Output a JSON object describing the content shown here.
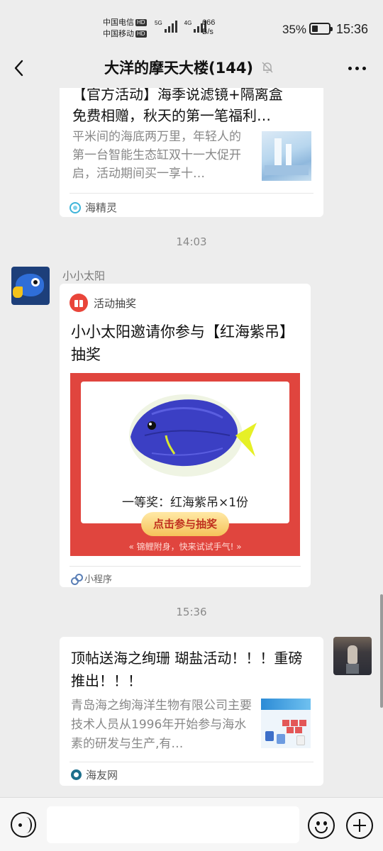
{
  "status_bar": {
    "carrier1": "中国电信",
    "carrier2": "中国移动",
    "hd": "HD",
    "net1": "5G",
    "net2": "4G",
    "speed_value": "666",
    "speed_unit": "B/s",
    "battery_percent": "35%",
    "battery_level": 0.35,
    "time": "15:36"
  },
  "header": {
    "title": "大洋的摩天大楼(144)",
    "icons": {
      "back": "chevron-left-icon",
      "mute": "bell-off-icon",
      "more": "more-horizontal-icon"
    }
  },
  "messages": {
    "article1": {
      "title_line1": "【官方活动】海季说滤镜+隔离盒",
      "title_line2": "免费相赠，秋天的第一笔福利…",
      "desc": "平米间的海底两万里，年轻人的第一台智能生态缸双十一大促开启，活动期间买一享十…",
      "source": "海精灵"
    },
    "time1": "14:03",
    "lottery": {
      "sender": "小小太阳",
      "tag": "活动抽奖",
      "title": "小小太阳邀请你参与【红海紫吊】抽奖",
      "prize": "一等奖：红海紫吊×1份",
      "button": "点击参与抽奖",
      "slogan": "«   锦鲤附身，快来试试手气!   »",
      "source": "小程序"
    },
    "time2": "15:36",
    "article2": {
      "title": "顶帖送海之绚珊 瑚盐活动！！！重磅推出！！！",
      "desc": "青岛海之绚海洋生物有限公司主要技术人员从1996年开始参与海水素的研发与生产,有…",
      "source": "海友网"
    }
  },
  "input_bar": {
    "placeholder": "",
    "icons": {
      "voice": "voice-icon",
      "emoji": "emoji-icon",
      "plus": "plus-icon"
    }
  },
  "colors": {
    "background": "#ededed",
    "banner_red": "#e0453e",
    "fish_blue": "#3b3fc4",
    "fish_tail": "#e6f026"
  }
}
